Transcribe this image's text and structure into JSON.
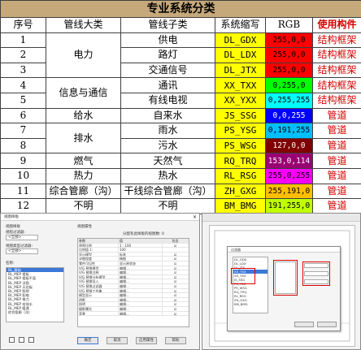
{
  "table": {
    "title": "专业系统分类",
    "headers": [
      "序号",
      "管线大类",
      "管线子类",
      "系统缩写",
      "RGB",
      "使用构件"
    ],
    "groups": [
      {
        "label": "电力",
        "rowspan": 3
      },
      {
        "label": "信息与通信",
        "rowspan": 2
      },
      {
        "label": "给水",
        "rowspan": 1
      },
      {
        "label": "排水",
        "rowspan": 2
      },
      {
        "label": "燃气",
        "rowspan": 1
      },
      {
        "label": "热力",
        "rowspan": 1
      },
      {
        "label": "综合管廊（沟）",
        "rowspan": 1
      },
      {
        "label": "不明",
        "rowspan": 1
      }
    ],
    "rows": [
      {
        "no": "1",
        "sub": "供电",
        "code": "DL_GDX",
        "rgb": "255,0,0",
        "use": "结构框架",
        "code_bg": "#ffff00",
        "rgb_bg": "#ff0000",
        "rgb_fg": "#000000"
      },
      {
        "no": "2",
        "sub": "路灯",
        "code": "DL_LDX",
        "rgb": "255,0,0",
        "use": "结构框架",
        "code_bg": "#ffff00",
        "rgb_bg": "#ff0000",
        "rgb_fg": "#000000"
      },
      {
        "no": "3",
        "sub": "交通信号",
        "code": "DL_JTX",
        "rgb": "255,0,0",
        "use": "结构框架",
        "code_bg": "#ffff00",
        "rgb_bg": "#ff0000",
        "rgb_fg": "#000000"
      },
      {
        "no": "4",
        "sub": "通讯",
        "code": "XX_TXX",
        "rgb": "0,255,0",
        "use": "结构框架",
        "code_bg": "#ffff00",
        "rgb_bg": "#00ff00",
        "rgb_fg": "#000000"
      },
      {
        "no": "5",
        "sub": "有线电视",
        "code": "XX_YXX",
        "rgb": "0,255,255",
        "use": "结构框架",
        "code_bg": "#ffff00",
        "rgb_bg": "#00ffff",
        "rgb_fg": "#000000"
      },
      {
        "no": "6",
        "sub": "自来水",
        "code": "JS_SSG",
        "rgb": "0,0,255",
        "use": "管道",
        "code_bg": "#ffff00",
        "rgb_bg": "#0000ff",
        "rgb_fg": "#ffffff"
      },
      {
        "no": "7",
        "sub": "雨水",
        "code": "PS_YSG",
        "rgb": "0,191,255",
        "use": "管道",
        "code_bg": "#ffff00",
        "rgb_bg": "#00bfff",
        "rgb_fg": "#000000"
      },
      {
        "no": "8",
        "sub": "污水",
        "code": "PS_WSG",
        "rgb": "127,0,0",
        "use": "管道",
        "code_bg": "#ffff00",
        "rgb_bg": "#7f0000",
        "rgb_fg": "#ffffff"
      },
      {
        "no": "9",
        "sub": "天然气",
        "code": "RQ_TRQ",
        "rgb": "153,0,114",
        "use": "管道",
        "code_bg": "#ffff00",
        "rgb_bg": "#990072",
        "rgb_fg": "#ffffff"
      },
      {
        "no": "10",
        "sub": "热水",
        "code": "RL_RSG",
        "rgb": "255,0,255",
        "use": "管道",
        "code_bg": "#ffff00",
        "rgb_bg": "#ff00ff",
        "rgb_fg": "#000000"
      },
      {
        "no": "11",
        "sub": "干线综合管廊（沟）",
        "code": "ZH_GXG",
        "rgb": "255,191,0",
        "use": "管道",
        "code_bg": "#ffff00",
        "rgb_bg": "#ffbf00",
        "rgb_fg": "#000000"
      },
      {
        "no": "12",
        "sub": "不明",
        "code": "BM_BMG",
        "rgb": "191,255,0",
        "use": "管道",
        "code_bg": "#ffff00",
        "rgb_bg": "#bfff00",
        "rgb_fg": "#000000"
      }
    ]
  },
  "left_dialog": {
    "title": "视图样板",
    "section_left": "视图样板",
    "filter_label_1": "规程过滤器:",
    "filter_value_1": "<全部>",
    "filter_label_2": "视图类型过滤器:",
    "filter_value_2": "<全部>",
    "names_label": "名称:",
    "names": [
      "BL_基础",
      "BL_MEP 楼板",
      "BL_MEP 楼板平面",
      "BL_MEP 详图",
      "BL_MEP 天花板",
      "BL_MEP 照明",
      "BL_MEP 配电",
      "BL_MEP 电力",
      "BL_MEP 给排水",
      "BL_MEP 暖通",
      "综合管廊（沟）"
    ],
    "section_right": "视图属性",
    "assign_info": "分配有此样板的视图数: 0",
    "prop_headers": [
      "参数",
      "值",
      "包含"
    ],
    "props": [
      {
        "p": "视图比例",
        "v": "1 : 100",
        "c": "☑"
      },
      {
        "p": "比例值 1:",
        "v": "100",
        "c": ""
      },
      {
        "p": "显示模型",
        "v": "标准",
        "c": "☑"
      },
      {
        "p": "详细程度",
        "v": "精细",
        "c": "☑"
      },
      {
        "p": "零件可见性",
        "v": "显示原状态",
        "c": "☑"
      },
      {
        "p": "V/G 替换模型",
        "v": "编辑...",
        "c": "☑"
      },
      {
        "p": "V/G 替换注释",
        "v": "编辑...",
        "c": "☑"
      },
      {
        "p": "V/G 替换分析模型",
        "v": "编辑...",
        "c": "☑"
      },
      {
        "p": "V/G 替换导入",
        "v": "编辑...",
        "c": "☑"
      },
      {
        "p": "V/G 替换过滤器",
        "v": "编辑...",
        "c": "☑"
      },
      {
        "p": "V/G 替换工作集",
        "v": "编辑...",
        "c": "☑"
      },
      {
        "p": "模型显示",
        "v": "编辑...",
        "c": "☑"
      },
      {
        "p": "阴影",
        "v": "编辑...",
        "c": "☑"
      },
      {
        "p": "照明",
        "v": "编辑...",
        "c": "☑"
      },
      {
        "p": "摄影曝光",
        "v": "编辑...",
        "c": "☑"
      },
      {
        "p": "背景",
        "v": "编辑...",
        "c": "☑"
      }
    ],
    "btn_ok": "确定",
    "btn_cancel": "取消",
    "btn_apply": "应用属性",
    "btn_help": "帮助"
  },
  "right_dialog": {
    "title": "过滤器",
    "list": [
      "DL_GDX",
      "DL_LDX",
      "DL_JTX",
      "XX_TXX",
      "XX_YXX",
      "JS_SSG",
      "PS_YSG",
      "PS_WSG",
      "RQ_TRQ",
      "RL_RSG",
      "ZH_GXG",
      "BM_BMG"
    ]
  }
}
